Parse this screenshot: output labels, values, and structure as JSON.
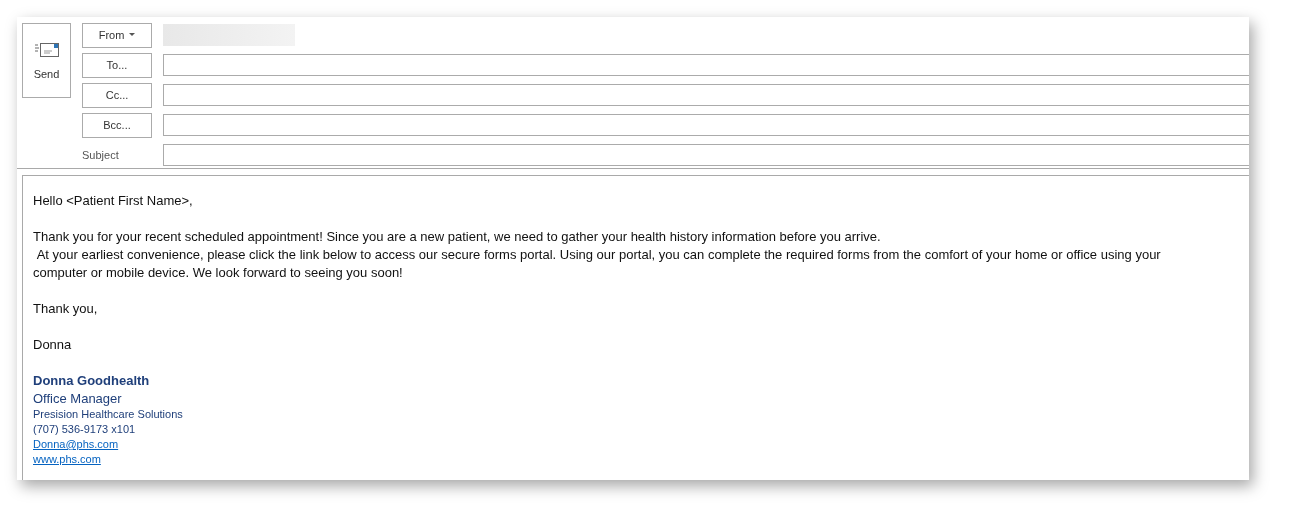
{
  "send_button": {
    "label": "Send"
  },
  "header_buttons": [
    {
      "label": "From",
      "kind": "dropdown"
    },
    {
      "label": "To...",
      "kind": "field"
    },
    {
      "label": "Cc...",
      "kind": "field"
    },
    {
      "label": "Bcc...",
      "kind": "field"
    }
  ],
  "subject": {
    "label": "Subject"
  },
  "body": {
    "greeting": "Hello <Patient First Name>,",
    "paragraphs": [
      "Thank you for your recent scheduled appointment! Since you are a new patient, we need to gather your health history information before you arrive.",
      " At your earliest convenience, please click the link below to access our secure forms portal. Using our portal, you can complete the required forms from the comfort of your home or office using your computer or mobile device. We look forward to seeing you soon!"
    ],
    "closing": "Thank you,",
    "sender": "Donna"
  },
  "signature": {
    "name": "Donna Goodhealth",
    "title": "Office Manager",
    "company": "Presision Healthcare Solutions",
    "phone": "(707) 536-9173 x101",
    "email": "Donna@phs.com",
    "website": "www.phs.com"
  }
}
